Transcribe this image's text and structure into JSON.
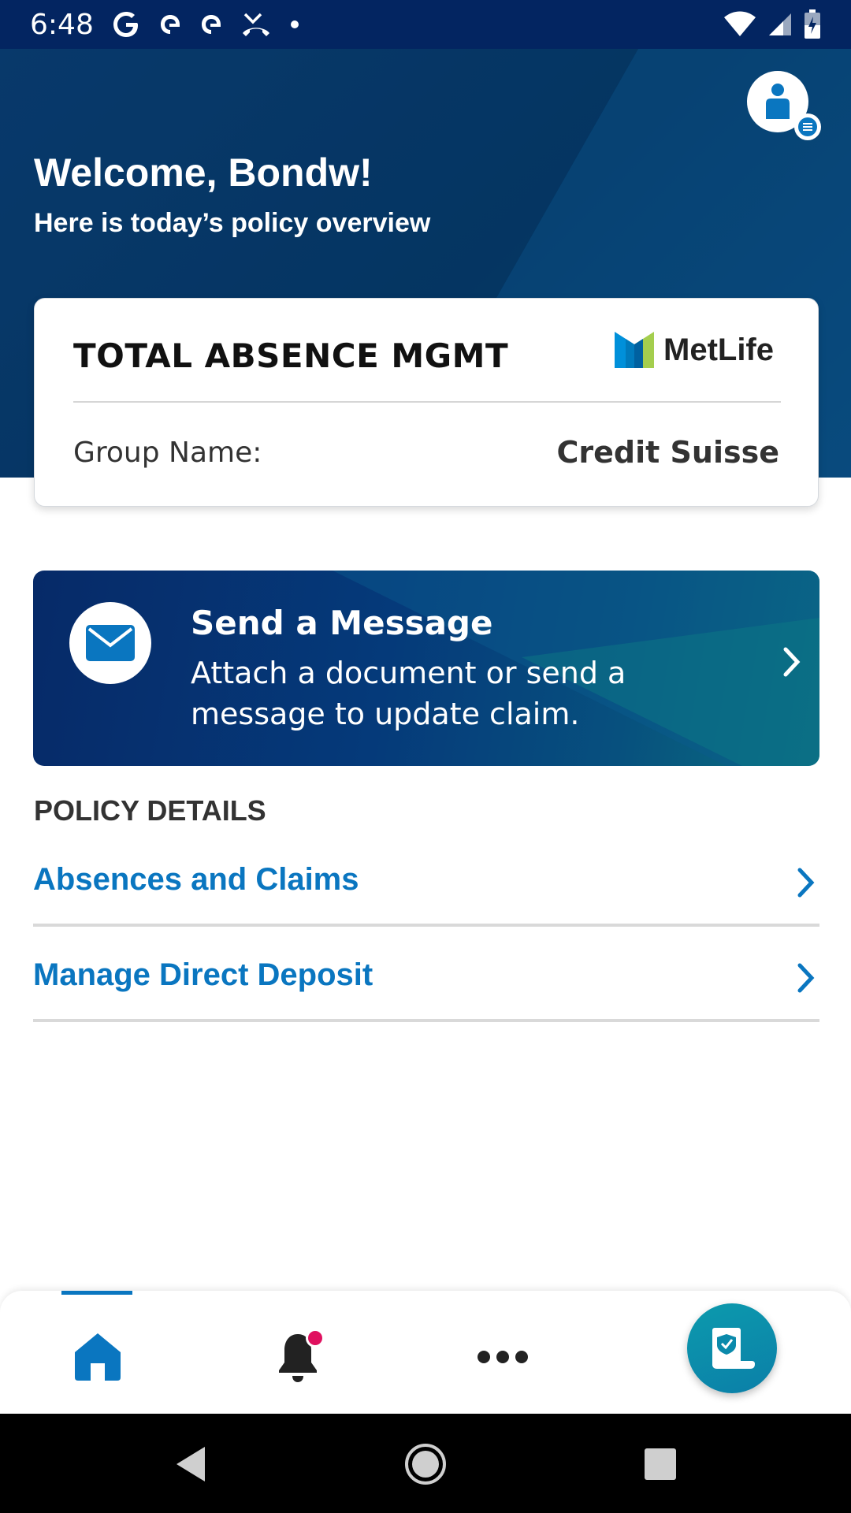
{
  "status_bar": {
    "time": "6:48",
    "left_icons": [
      "google-icon",
      "app-icon",
      "app-icon",
      "missed-call-icon",
      "dot-icon"
    ],
    "right_icons": [
      "wifi-icon",
      "signal-icon",
      "battery-icon"
    ]
  },
  "header": {
    "welcome": "Welcome, Bondw!",
    "subtitle": "Here is today’s policy overview"
  },
  "policy_card": {
    "title": "TOTAL ABSENCE MGMT",
    "brand": "MetLife",
    "group_label": "Group Name:",
    "group_value": "Credit Suisse"
  },
  "message_banner": {
    "title": "Send a Message",
    "description": "Attach a document or send a message to update claim."
  },
  "policy_details": {
    "title": "POLICY DETAILS",
    "items": [
      {
        "label": "Absences and Claims"
      },
      {
        "label": "Manage Direct Deposit"
      }
    ]
  },
  "bottom_nav": {
    "items": [
      "home-icon",
      "bell-icon",
      "more-icon"
    ],
    "active": "home",
    "has_notification": true,
    "fab_icon": "policy-document-icon"
  },
  "colors": {
    "header_navy": "#053864",
    "link_blue": "#0a76c0",
    "notification": "#e0115f",
    "fab_teal": "#0c9aad"
  }
}
